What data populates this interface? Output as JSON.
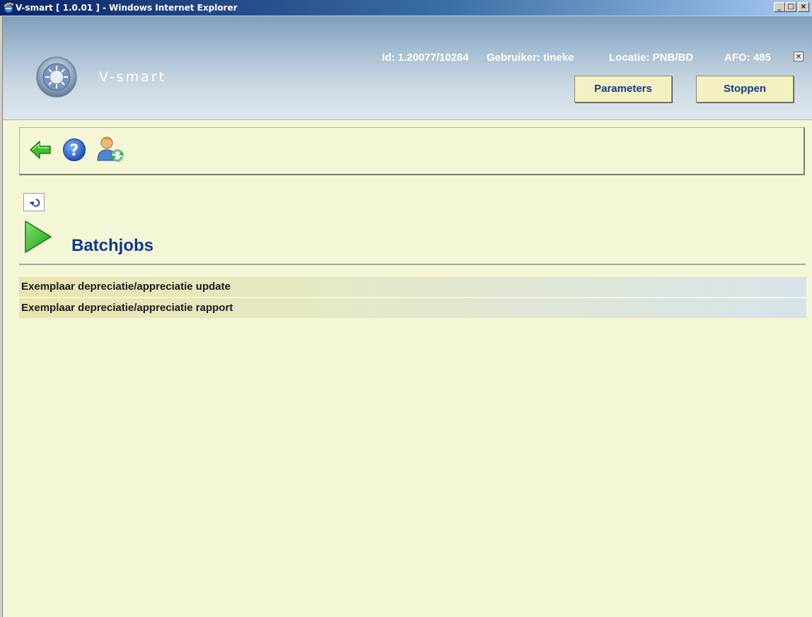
{
  "window": {
    "title": "V-smart [ 1.0.01 ] - Windows Internet Explorer",
    "minimize_label": "_",
    "maximize_label": "□",
    "close_label": "×"
  },
  "header": {
    "brand": "V-smart",
    "id_text": "Id: 1.20077/10284",
    "user_text": "Gebruiker: tineke",
    "location_text": "Locatie: PNB/BD",
    "afo_text": "AFO: 485",
    "close_label": "×",
    "parameters_label": "Parameters",
    "stop_label": "Stoppen"
  },
  "toolbar": {
    "icons": [
      "back-arrow-icon",
      "help-icon",
      "switch-user-icon"
    ]
  },
  "section": {
    "title": "Batchjobs"
  },
  "jobs": [
    {
      "label": "Exemplaar depreciatie/appreciatie update"
    },
    {
      "label": "Exemplaar depreciatie/appreciatie rapport"
    }
  ],
  "colors": {
    "page_background": "#f5f6d6",
    "title_blue": "#0d3a8c",
    "button_bg": "#f3f0c2",
    "header_top": "#7e9fbb"
  }
}
